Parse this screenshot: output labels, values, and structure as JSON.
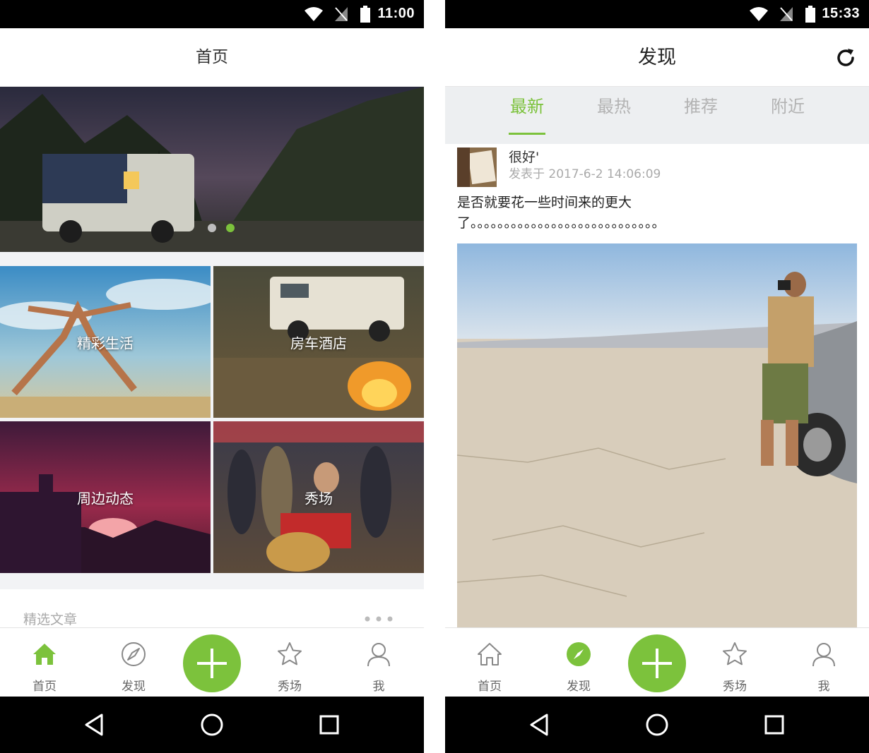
{
  "colors": {
    "accent": "#7cc23c",
    "status_bar": "#000000",
    "tab_bg": "#edeff1",
    "inactive_text": "#b3b3b3"
  },
  "left_screen": {
    "status_bar": {
      "time": "11:00"
    },
    "header": {
      "title": "首页"
    },
    "banner": {
      "page_count": 2,
      "active_page": 2
    },
    "tiles": [
      {
        "label": "精彩生活"
      },
      {
        "label": "房车酒店"
      },
      {
        "label": "周边动态"
      },
      {
        "label": "秀场"
      }
    ],
    "section": {
      "title": "精选文章",
      "more_icon": "more-dots-icon"
    },
    "tab_bar": {
      "items": [
        {
          "label": "首页",
          "icon": "home-icon"
        },
        {
          "label": "发现",
          "icon": "compass-icon"
        },
        {
          "label": "",
          "icon": "plus-icon"
        },
        {
          "label": "秀场",
          "icon": "star-icon"
        },
        {
          "label": "我",
          "icon": "user-icon"
        }
      ],
      "active": "首页"
    }
  },
  "right_screen": {
    "status_bar": {
      "time": "15:33"
    },
    "header": {
      "title": "发现",
      "action_icon": "refresh-icon"
    },
    "tabs": [
      {
        "label": "最新"
      },
      {
        "label": "最热"
      },
      {
        "label": "推荐"
      },
      {
        "label": "附近"
      }
    ],
    "active_tab": "最新",
    "post": {
      "author": "很好'",
      "time": "发表于 2017-6-2 14:06:09",
      "text_line1": "是否就要花一些时间来的更大",
      "text_line2": "了。。。。。。。。。。。。。。。。。。。。。。。。。。。。"
    },
    "tab_bar": {
      "items": [
        {
          "label": "首页",
          "icon": "home-icon"
        },
        {
          "label": "发现",
          "icon": "compass-icon"
        },
        {
          "label": "",
          "icon": "plus-icon"
        },
        {
          "label": "秀场",
          "icon": "star-icon"
        },
        {
          "label": "我",
          "icon": "user-icon"
        }
      ],
      "active": "发现"
    }
  },
  "android_nav": {
    "icons": [
      "back-icon",
      "home-circle-icon",
      "recents-icon"
    ]
  }
}
